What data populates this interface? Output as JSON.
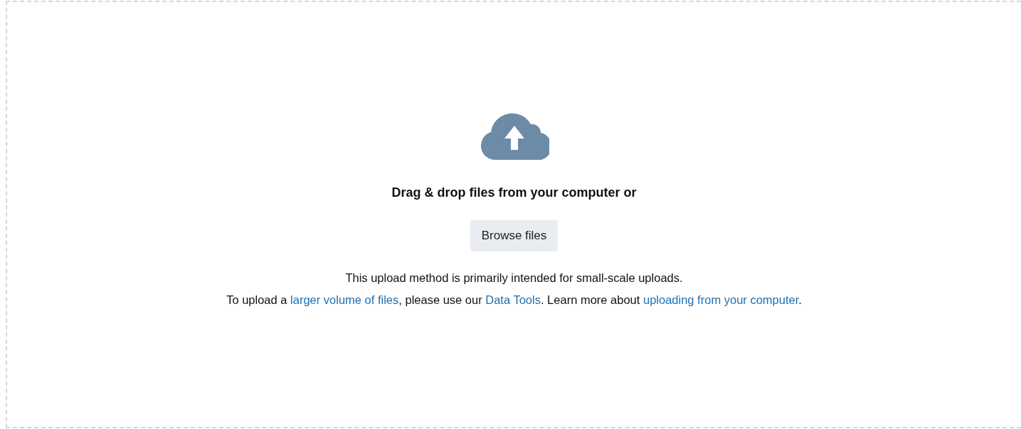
{
  "dropzone": {
    "heading": "Drag & drop files from your computer or",
    "button": "Browse files",
    "note_lines": [
      [
        {
          "kind": "text",
          "text": "This upload method is primarily intended for small-scale uploads."
        }
      ],
      [
        {
          "kind": "text",
          "text": "To upload a "
        },
        {
          "kind": "link",
          "text": "larger volume of files"
        },
        {
          "kind": "text",
          "text": ", please use our "
        },
        {
          "kind": "link",
          "text": "Data Tools"
        },
        {
          "kind": "text",
          "text": ". Learn more about "
        },
        {
          "kind": "link",
          "text": "uploading from your computer"
        },
        {
          "kind": "text",
          "text": "."
        }
      ]
    ]
  }
}
